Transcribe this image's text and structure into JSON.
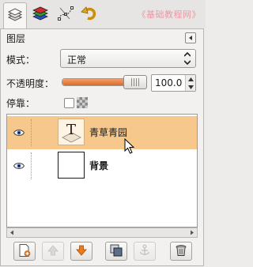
{
  "dock": {
    "tabs": [
      {
        "name": "layers",
        "icon": "layers-icon",
        "active": true
      },
      {
        "name": "channels",
        "icon": "channels-icon",
        "active": false
      },
      {
        "name": "paths",
        "icon": "paths-icon",
        "active": false
      },
      {
        "name": "undo-history",
        "icon": "undo-history-icon",
        "active": false
      }
    ],
    "watermark": "《基础教程网》"
  },
  "panel": {
    "title": "图层",
    "mode_label": "模式：",
    "mode_value": "正常",
    "opacity_label": "不透明度：",
    "opacity_value": "100.0",
    "opacity_percent": 100,
    "lock_label": "停靠："
  },
  "layers": [
    {
      "name": "青草青园",
      "type": "text",
      "visible": true,
      "selected": true
    },
    {
      "name": "背景",
      "type": "image",
      "visible": true,
      "selected": false
    }
  ],
  "toolbar": [
    {
      "name": "new-layer",
      "icon": "new-layer-icon",
      "enabled": true
    },
    {
      "name": "raise-layer",
      "icon": "raise-layer-icon",
      "enabled": false
    },
    {
      "name": "lower-layer",
      "icon": "lower-layer-icon",
      "enabled": true
    },
    {
      "name": "duplicate-layer",
      "icon": "duplicate-layer-icon",
      "enabled": true
    },
    {
      "name": "anchor-layer",
      "icon": "anchor-icon",
      "enabled": false
    },
    {
      "name": "delete-layer",
      "icon": "trash-icon",
      "enabled": true
    }
  ],
  "colors": {
    "selected_row": "#f7c88c",
    "slider_fill": "#e06a20",
    "watermark": "#e79aa5"
  }
}
